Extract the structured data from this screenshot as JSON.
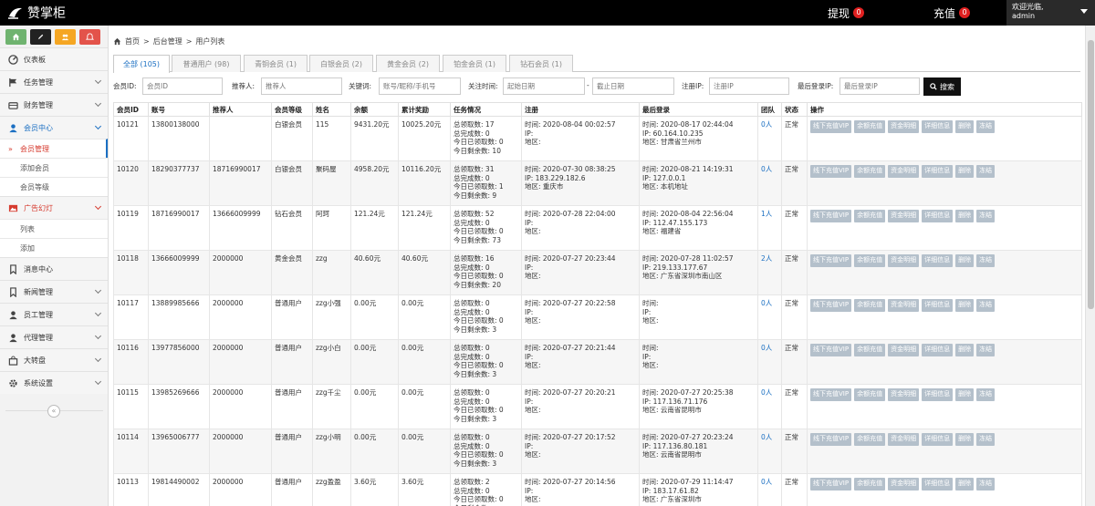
{
  "topbar": {
    "brand": "赞掌柜",
    "withdraw_label": "提现",
    "withdraw_count": "0",
    "recharge_label": "充值",
    "recharge_count": "0",
    "welcome": "欢迎光临,",
    "username": "admin"
  },
  "sidebar": {
    "shortcuts": [
      "home-icon",
      "pencil-icon",
      "users-icon",
      "bell-icon"
    ],
    "items": [
      {
        "label": "仪表板",
        "icon": "dashboard-icon"
      },
      {
        "label": "任务管理",
        "icon": "flag-icon"
      },
      {
        "label": "财务管理",
        "icon": "wallet-icon"
      },
      {
        "label": "会员中心",
        "icon": "user-icon"
      },
      {
        "label": "广告幻灯",
        "icon": "picture-icon"
      },
      {
        "label": "消息中心",
        "icon": "bookmark-icon"
      },
      {
        "label": "新闻管理",
        "icon": "bookmark-icon"
      },
      {
        "label": "员工管理",
        "icon": "user-icon"
      },
      {
        "label": "代理管理",
        "icon": "user-icon"
      },
      {
        "label": "大转盘",
        "icon": "bag-icon"
      },
      {
        "label": "系统设置",
        "icon": "gear-icon"
      }
    ],
    "member_sub": [
      "会员管理",
      "添加会员",
      "会员等级"
    ],
    "ad_sub": [
      "列表",
      "添加"
    ],
    "collapse": "«"
  },
  "breadcrumb": [
    "首页",
    "后台管理",
    "用户列表"
  ],
  "tabs": [
    "全部 (105)",
    "普通用户 (98)",
    "青铜会员 (1)",
    "白银会员 (2)",
    "黄金会员 (2)",
    "铂金会员 (1)",
    "钻石会员 (1)"
  ],
  "filters": {
    "member_id_label": "会员ID:",
    "member_id_ph": "会员ID",
    "referrer_label": "推荐人:",
    "referrer_ph": "推荐人",
    "keyword_label": "关键词:",
    "keyword_ph": "账号/昵称/手机号",
    "focus_time_label": "关注时间:",
    "start_ph": "起始日期",
    "sep": "-",
    "end_ph": "截止日期",
    "reg_ip_label": "注册IP:",
    "reg_ip_ph": "注册IP",
    "last_ip_label": "最后登录IP:",
    "last_ip_ph": "最后登录IP",
    "search": "搜索"
  },
  "table": {
    "headers": [
      "会员ID",
      "账号",
      "推荐人",
      "会员等级",
      "姓名",
      "余额",
      "累计奖励",
      "任务情况",
      "注册",
      "最后登录",
      "团队",
      "状态",
      "操作"
    ],
    "task_labels": [
      "总领取数: ",
      "总完成数: ",
      "今日已领取数: ",
      "今日剩余数: "
    ],
    "reg_labels": [
      "时间: ",
      "IP: ",
      "地区: "
    ],
    "ops": [
      "线下充值VIP",
      "余额充值",
      "资金明细",
      "详细信息",
      "删除",
      "冻结"
    ],
    "rows": [
      {
        "id": "10121",
        "account": "13800138000",
        "referrer": "",
        "level": "白银会员",
        "name": "115",
        "balance": "9431.20元",
        "reward": "10025.20元",
        "task": [
          "17",
          "0",
          "0",
          "10"
        ],
        "reg": [
          "2020-08-04 00:02:57",
          "",
          ""
        ],
        "last": [
          "2020-08-17 02:44:04",
          "60.164.10.235",
          "甘肃省兰州市"
        ],
        "team": "0人",
        "status": "正常"
      },
      {
        "id": "10120",
        "account": "18290377737",
        "referrer": "18716990017",
        "level": "白银会员",
        "name": "聚码屋",
        "balance": "4958.20元",
        "reward": "10116.20元",
        "task": [
          "31",
          "0",
          "1",
          "9"
        ],
        "reg": [
          "2020-07-30 08:38:25",
          "183.229.182.6",
          "重庆市"
        ],
        "last": [
          "2020-08-21 14:19:31",
          "127.0.0.1",
          "本机地址"
        ],
        "team": "0人",
        "status": "正常"
      },
      {
        "id": "10119",
        "account": "18716990017",
        "referrer": "13666009999",
        "level": "钻石会员",
        "name": "阿珂",
        "balance": "121.24元",
        "reward": "121.24元",
        "task": [
          "52",
          "0",
          "0",
          "73"
        ],
        "reg": [
          "2020-07-28 22:04:00",
          "",
          ""
        ],
        "last": [
          "2020-08-04 22:56:04",
          "112.47.155.173",
          "福建省"
        ],
        "team": "1人",
        "status": "正常"
      },
      {
        "id": "10118",
        "account": "13666009999",
        "referrer": "2000000",
        "level": "黄金会员",
        "name": "zzg",
        "balance": "40.60元",
        "reward": "40.60元",
        "task": [
          "16",
          "0",
          "0",
          "20"
        ],
        "reg": [
          "2020-07-27 20:23:44",
          "",
          ""
        ],
        "last": [
          "2020-07-28 11:02:57",
          "219.133.177.67",
          "广东省深圳市南山区"
        ],
        "team": "2人",
        "status": "正常"
      },
      {
        "id": "10117",
        "account": "13889985666",
        "referrer": "2000000",
        "level": "普通用户",
        "name": "zzg小强",
        "balance": "0.00元",
        "reward": "0.00元",
        "task": [
          "0",
          "0",
          "0",
          "3"
        ],
        "reg": [
          "2020-07-27 20:22:58",
          "",
          ""
        ],
        "last": [
          "",
          "",
          ""
        ],
        "team": "0人",
        "status": "正常"
      },
      {
        "id": "10116",
        "account": "13977856000",
        "referrer": "2000000",
        "level": "普通用户",
        "name": "zzg小白",
        "balance": "0.00元",
        "reward": "0.00元",
        "task": [
          "0",
          "0",
          "0",
          "3"
        ],
        "reg": [
          "2020-07-27 20:21:44",
          "",
          ""
        ],
        "last": [
          "",
          "",
          ""
        ],
        "team": "0人",
        "status": "正常"
      },
      {
        "id": "10115",
        "account": "13985269666",
        "referrer": "2000000",
        "level": "普通用户",
        "name": "zzg千尘",
        "balance": "0.00元",
        "reward": "0.00元",
        "task": [
          "0",
          "0",
          "0",
          "3"
        ],
        "reg": [
          "2020-07-27 20:20:21",
          "",
          ""
        ],
        "last": [
          "2020-07-27 20:25:38",
          "117.136.71.176",
          "云南省昆明市"
        ],
        "team": "0人",
        "status": "正常"
      },
      {
        "id": "10114",
        "account": "13965006777",
        "referrer": "2000000",
        "level": "普通用户",
        "name": "zzg小明",
        "balance": "0.00元",
        "reward": "0.00元",
        "task": [
          "0",
          "0",
          "0",
          "3"
        ],
        "reg": [
          "2020-07-27 20:17:52",
          "",
          ""
        ],
        "last": [
          "2020-07-27 20:23:24",
          "117.136.80.181",
          "云南省昆明市"
        ],
        "team": "0人",
        "status": "正常"
      },
      {
        "id": "10113",
        "account": "19814490002",
        "referrer": "2000000",
        "level": "普通用户",
        "name": "zzg盈盈",
        "balance": "3.60元",
        "reward": "3.60元",
        "task": [
          "2",
          "0",
          "0",
          ""
        ],
        "reg": [
          "2020-07-27 20:14:56",
          "",
          ""
        ],
        "last": [
          "2020-07-29 11:14:47",
          "183.17.61.82",
          "广东省深圳市"
        ],
        "team": "0人",
        "status": "正常"
      }
    ]
  }
}
